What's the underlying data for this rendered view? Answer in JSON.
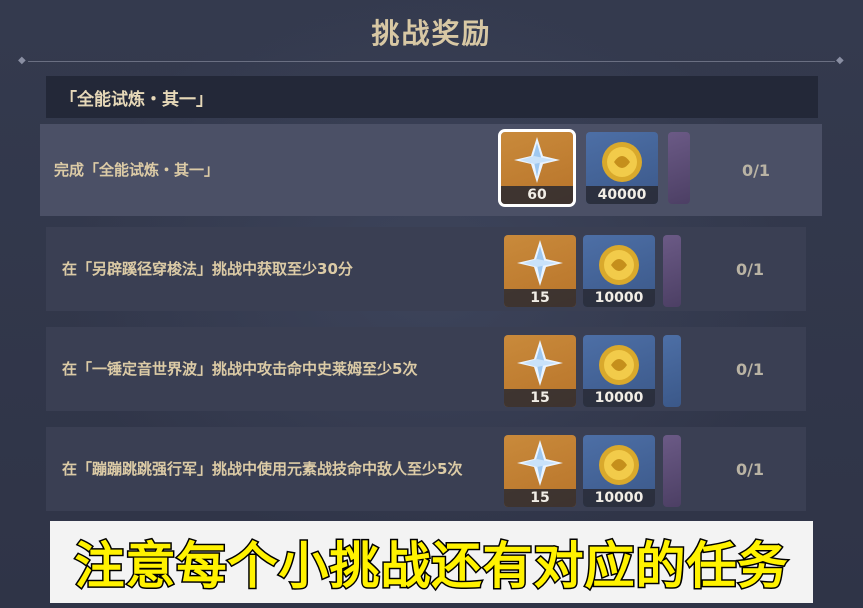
{
  "header": {
    "title": "挑战奖励"
  },
  "section": {
    "title": "「全能试炼・其一」"
  },
  "challenges": [
    {
      "description": "完成「全能试炼・其一」",
      "rewards": [
        {
          "icon": "primogem-icon",
          "count": "60"
        },
        {
          "icon": "mora-coin-icon",
          "count": "40000"
        }
      ],
      "progress": "0/1"
    },
    {
      "description": "在「另辟蹊径穿梭法」挑战中获取至少30分",
      "rewards": [
        {
          "icon": "primogem-icon",
          "count": "15"
        },
        {
          "icon": "mora-coin-icon",
          "count": "10000"
        }
      ],
      "progress": "0/1"
    },
    {
      "description": "在「一锤定音世界波」挑战中攻击命中史莱姆至少5次",
      "rewards": [
        {
          "icon": "primogem-icon",
          "count": "15"
        },
        {
          "icon": "mora-coin-icon",
          "count": "10000"
        }
      ],
      "progress": "0/1"
    },
    {
      "description": "在「蹦蹦跳跳强行军」挑战中使用元素战技命中敌人至少5次",
      "rewards": [
        {
          "icon": "primogem-icon",
          "count": "15"
        },
        {
          "icon": "mora-coin-icon",
          "count": "10000"
        }
      ],
      "progress": "0/1"
    }
  ],
  "caption": {
    "text": "注意每个小挑战还有对应的任务"
  },
  "colors": {
    "background": "#2f3447",
    "gem_tile": "#c98a3b",
    "coin_tile": "#4d6fa6",
    "caption_text": "#fff200"
  }
}
